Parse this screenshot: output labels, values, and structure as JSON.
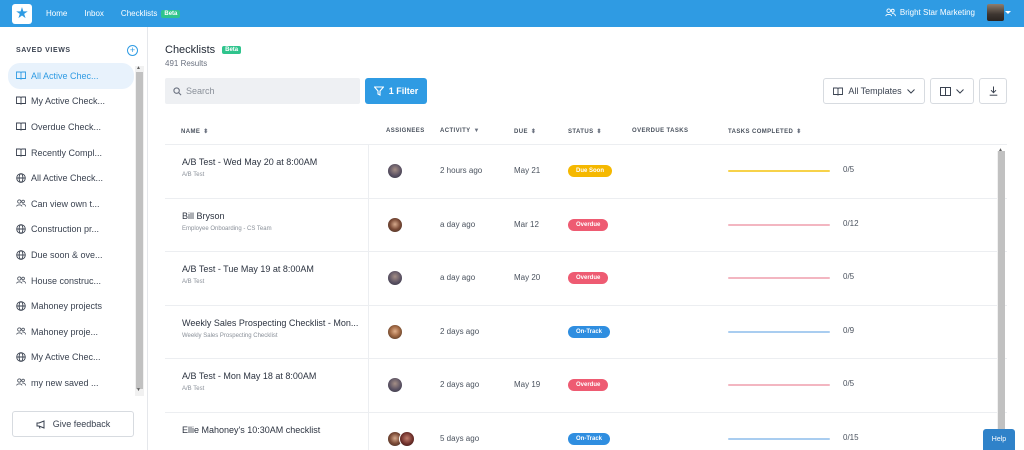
{
  "topbar": {
    "nav": [
      "Home",
      "Inbox",
      "Checklists"
    ],
    "beta": "Beta",
    "account_name": "Bright Star Marketing",
    "accent": "#2f9be3"
  },
  "sidebar": {
    "header": "SAVED VIEWS",
    "add_icon": "plus-circle-icon",
    "items": [
      {
        "label": "All Active Chec...",
        "icon": "book-icon",
        "active": true
      },
      {
        "label": "My Active Check...",
        "icon": "book-icon",
        "active": false
      },
      {
        "label": "Overdue Check...",
        "icon": "book-icon",
        "active": false
      },
      {
        "label": "Recently Compl...",
        "icon": "book-icon",
        "active": false
      },
      {
        "label": "All Active Check...",
        "icon": "globe-icon",
        "active": false
      },
      {
        "label": "Can view own t...",
        "icon": "users-icon",
        "active": false
      },
      {
        "label": "Construction pr...",
        "icon": "globe-icon",
        "active": false
      },
      {
        "label": "Due soon & ove...",
        "icon": "globe-icon",
        "active": false
      },
      {
        "label": "House construc...",
        "icon": "users-icon",
        "active": false
      },
      {
        "label": "Mahoney projects",
        "icon": "globe-icon",
        "active": false
      },
      {
        "label": "Mahoney proje...",
        "icon": "users-icon",
        "active": false
      },
      {
        "label": "My Active Chec...",
        "icon": "globe-icon",
        "active": false
      },
      {
        "label": "my new saved ...",
        "icon": "users-icon",
        "active": false
      }
    ],
    "feedback": "Give feedback"
  },
  "main": {
    "title": "Checklists",
    "beta": "Beta",
    "results": "491 Results",
    "search_placeholder": "Search",
    "filter_label": "1 Filter",
    "templates_label": "All Templates",
    "columns": [
      "NAME",
      "ASSIGNEES",
      "ACTIVITY",
      "DUE",
      "STATUS",
      "OVERDUE TASKS",
      "TASKS COMPLETED"
    ],
    "rows": [
      {
        "name": "A/B Test - Wed May 20 at 8:00AM",
        "sub": "A/B Test",
        "avatars": [
          "a"
        ],
        "activity": "2 hours ago",
        "due": "May 21",
        "status": "Due Soon",
        "status_color": "#f5b800",
        "progress_color": "#f7d24a",
        "completed": "0/5"
      },
      {
        "name": "Bill Bryson",
        "sub": "Employee Onboarding - CS Team",
        "avatars": [
          "b"
        ],
        "activity": "a day ago",
        "due": "Mar 12",
        "status": "Overdue",
        "status_color": "#ee5b72",
        "progress_color": "#f3b6c1",
        "completed": "0/12"
      },
      {
        "name": "A/B Test - Tue May 19 at 8:00AM",
        "sub": "A/B Test",
        "avatars": [
          "a"
        ],
        "activity": "a day ago",
        "due": "May 20",
        "status": "Overdue",
        "status_color": "#ee5b72",
        "progress_color": "#f3b6c1",
        "completed": "0/5"
      },
      {
        "name": "Weekly Sales Prospecting Checklist - Mon...",
        "sub": "Weekly Sales Prospecting Checklist",
        "avatars": [
          "c"
        ],
        "activity": "2 days ago",
        "due": "",
        "status": "On-Track",
        "status_color": "#2f8ee0",
        "progress_color": "#a9cdf0",
        "completed": "0/9"
      },
      {
        "name": "A/B Test - Mon May 18 at 8:00AM",
        "sub": "A/B Test",
        "avatars": [
          "a"
        ],
        "activity": "2 days ago",
        "due": "May 19",
        "status": "Overdue",
        "status_color": "#ee5b72",
        "progress_color": "#f3b6c1",
        "completed": "0/5"
      },
      {
        "name": "Ellie Mahoney's 10:30AM checklist",
        "sub": "",
        "avatars": [
          "b",
          "d"
        ],
        "activity": "5 days ago",
        "due": "",
        "status": "On-Track",
        "status_color": "#2f8ee0",
        "progress_color": "#a9cdf0",
        "completed": "0/15"
      }
    ]
  },
  "help": "Help"
}
